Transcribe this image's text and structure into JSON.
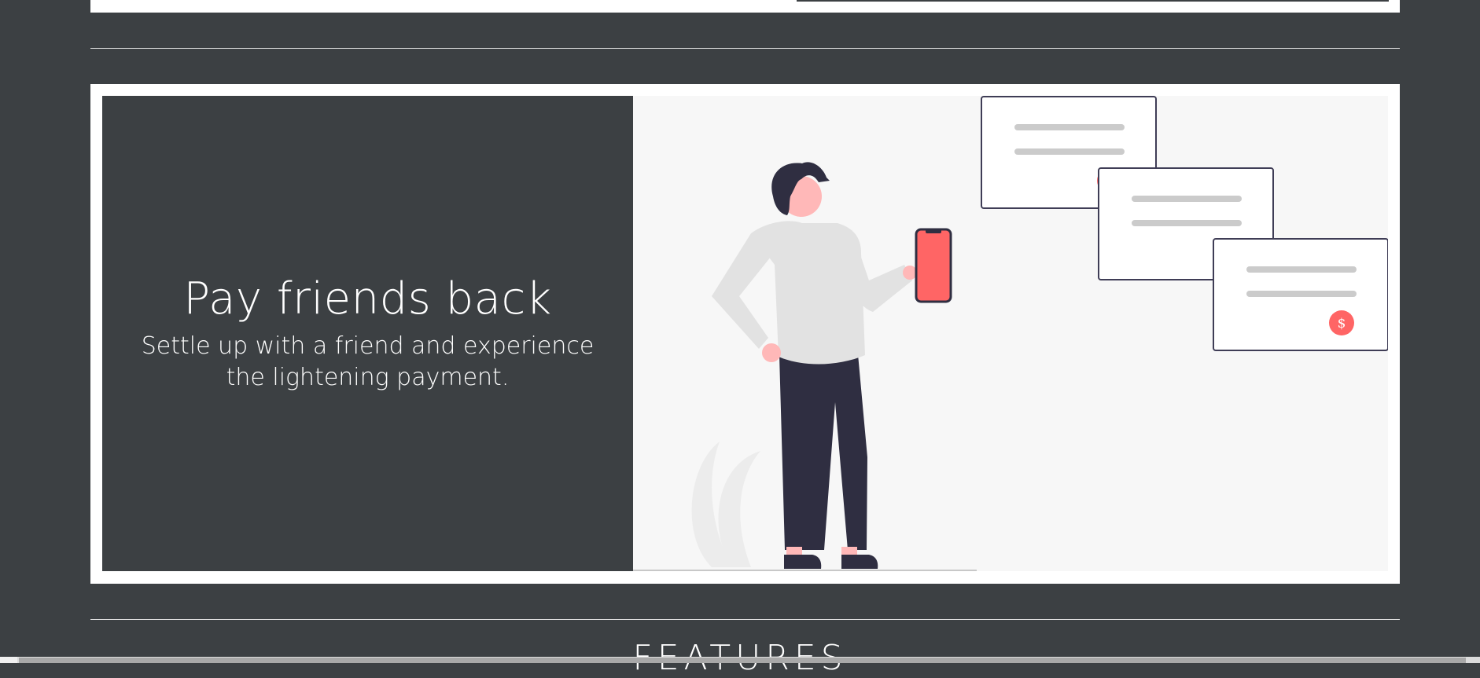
{
  "hero": {
    "title": "Pay friends back",
    "subtitle": "Settle up with a friend and experience the lightening payment."
  },
  "illustration": {
    "card_symbol": "$",
    "accent_color": "#ff6565",
    "dark_color": "#2f2e41"
  },
  "features": {
    "heading": "FEATURES"
  },
  "colors": {
    "background": "#3c4043",
    "card": "#ffffff",
    "illustration_bg": "#f7f7f7"
  }
}
